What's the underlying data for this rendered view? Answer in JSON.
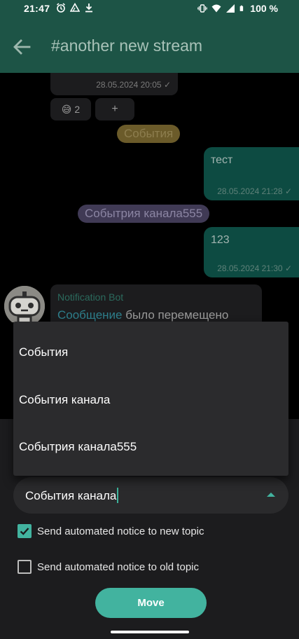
{
  "status_bar": {
    "time": "21:47",
    "battery": "100 %",
    "left_icons": [
      "alarm-icon",
      "drive-icon",
      "download-icon"
    ],
    "right_icons": [
      "vibrate-icon",
      "wifi-icon",
      "signal-icon",
      "battery-icon"
    ]
  },
  "app_bar": {
    "title": "#another new stream",
    "back_icon": "back-arrow-icon",
    "color": "#1d5446"
  },
  "chat": {
    "messages": [
      {
        "side": "left",
        "time": "28.05.2024 20:05 ✓"
      },
      {
        "side": "right",
        "text": "тест",
        "time": "28.05.2024 21:28 ✓"
      },
      {
        "side": "right",
        "text": "123",
        "time": "28.05.2024 21:30 ✓"
      }
    ],
    "reaction": {
      "emoji": "😅",
      "count": "2"
    },
    "reaction_add": "+",
    "topic_chips": [
      "События",
      "Событрия канала555"
    ],
    "bot_message": {
      "sender": "Notification Bot",
      "link_text": "Сообщение",
      "text": "было перемещено"
    }
  },
  "topic_dropdown": {
    "options": [
      "События",
      "События канала",
      "Событрия канала555"
    ]
  },
  "move_sheet": {
    "topic_value": "События канала",
    "notice_new": {
      "label": "Send automated notice to new topic",
      "checked": true
    },
    "notice_old": {
      "label": "Send automated notice to old topic",
      "checked": false
    },
    "move_label": "Move",
    "accent": "#42b39f"
  }
}
